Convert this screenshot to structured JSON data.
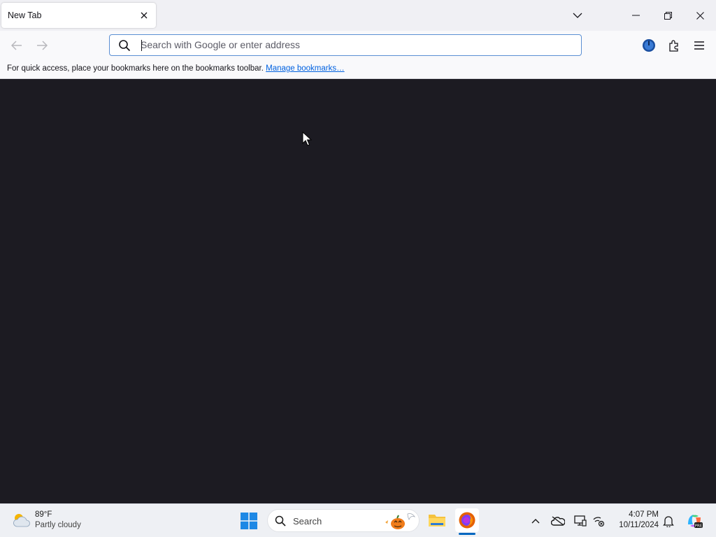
{
  "tab": {
    "title": "New Tab"
  },
  "urlbar": {
    "placeholder": "Search with Google or enter address"
  },
  "bookmarks_bar": {
    "message": "For quick access, place your bookmarks here on the bookmarks toolbar.",
    "link": "Manage bookmarks…"
  },
  "taskbar": {
    "weather": {
      "temp": "89°F",
      "desc": "Partly cloudy"
    },
    "search_label": "Search",
    "clock": {
      "time": "4:07 PM",
      "date": "10/11/2024"
    }
  },
  "icons": [
    "chevron-down-icon",
    "minimize-icon",
    "restore-icon",
    "close-icon",
    "back-arrow-icon",
    "forward-arrow-icon",
    "search-icon",
    "account-icon",
    "extensions-icon",
    "menu-icon",
    "windows-start-icon",
    "file-explorer-icon",
    "firefox-icon",
    "tray-chevron-icon",
    "onedrive-icon",
    "display-icon",
    "network-icon",
    "bell-icon",
    "copilot-icon"
  ],
  "colors": {
    "accent": "#0061e0",
    "content_bg": "#1c1b22",
    "urlbar_border": "#5b8fd3"
  }
}
